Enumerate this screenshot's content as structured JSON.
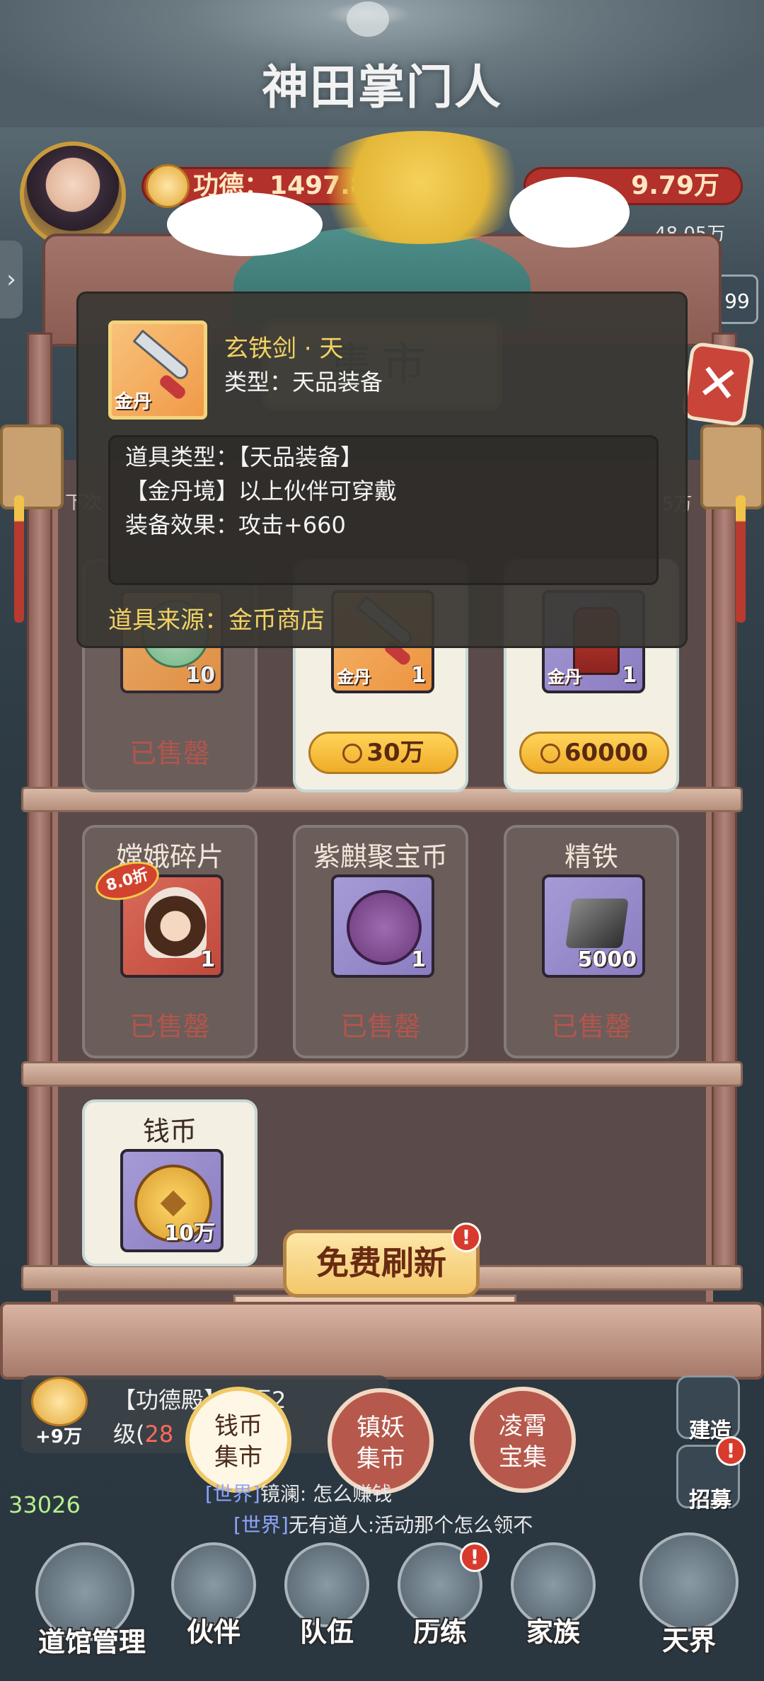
{
  "header": {
    "game_title": "神田掌门人",
    "merit_label": "功德：",
    "merit_value": "1497.8",
    "coins_value": "9.79万",
    "sub_value": "48.05万",
    "badge_99": "99"
  },
  "shop": {
    "plaque": "集市",
    "row_left_hint": "下次",
    "row_right_hint": "5万",
    "cards": [
      {
        "name": "",
        "rank": "",
        "qty": "10",
        "status": "已售罄",
        "bg": "#6fbf8a"
      },
      {
        "name": "",
        "rank": "金丹",
        "qty": "1",
        "price": "30万",
        "bg": "#f09a48"
      },
      {
        "name": "",
        "rank": "金丹",
        "qty": "1",
        "price": "60000",
        "bg": "#8a7cc1"
      },
      {
        "name": "嫦娥碎片",
        "qty": "1",
        "status": "已售罄",
        "discount": "8.0折"
      },
      {
        "name": "紫麒聚宝币",
        "qty": "1",
        "status": "已售罄"
      },
      {
        "name": "精铁",
        "qty": "5000",
        "status": "已售罄"
      },
      {
        "name": "钱币",
        "qty": "10万"
      }
    ],
    "refresh_button": "免费刷新",
    "refresh_alert": "!"
  },
  "tooltip": {
    "item_name": "玄铁剑 · 天",
    "type_line": "类型：天品装备",
    "icon_rank": "金丹",
    "line1": "道具类型：【天品装备】",
    "line2": "【金丹境】以上伙伴可穿戴",
    "line3": "装备效果：攻击+660",
    "source": "道具来源：金币商店"
  },
  "market_tabs": [
    {
      "line1": "钱币",
      "line2": "集市",
      "active": true
    },
    {
      "line1": "镇妖",
      "line2": "集市",
      "active": false
    },
    {
      "line1": "凌霄",
      "line2": "宝集",
      "active": false
    }
  ],
  "quest": {
    "text": "【功德殿】升至2",
    "level_prefix": "级(",
    "level_value": "28",
    "reward": "+9万"
  },
  "chat": {
    "online": "33026",
    "lines": [
      {
        "tag": "[世界]",
        "text": "镜澜: 怎么赚钱"
      },
      {
        "tag": "[世界]",
        "text": "无有道人:活动那个怎么领不"
      }
    ]
  },
  "side_buttons": {
    "build": "建造",
    "recruit": "招募",
    "recruit_alert": "!"
  },
  "nav": {
    "items": [
      "道馆管理",
      "伙伴",
      "队伍",
      "历练",
      "家族",
      "天界"
    ],
    "alert": "!"
  }
}
